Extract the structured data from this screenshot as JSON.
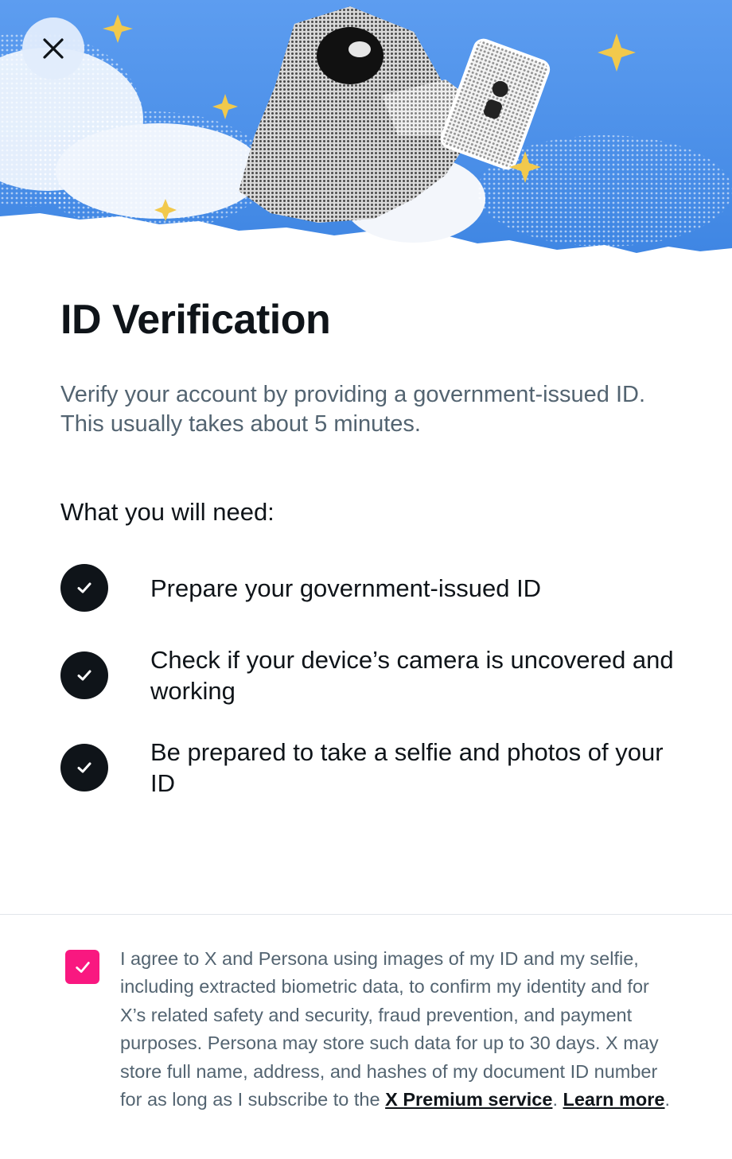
{
  "header": {
    "close_icon": "close-icon",
    "illustration": "astronaut-holding-id-card"
  },
  "main": {
    "title": "ID Verification",
    "subtitle": "Verify your account by providing a government-issued ID. This usually takes about 5 minutes.",
    "needs_heading": "What you will need:",
    "requirements": [
      {
        "icon": "check-circle-icon",
        "label": "Prepare your government-issued ID"
      },
      {
        "icon": "check-circle-icon",
        "label": "Check if your device’s camera is uncovered and working"
      },
      {
        "icon": "check-circle-icon",
        "label": "Be prepared to take a selfie and photos of your ID"
      }
    ]
  },
  "consent": {
    "checked": true,
    "text": "I agree to X and Persona using images of my ID and my selfie, including extracted biometric data, to confirm my identity and for X’s related safety and security, fraud prevention, and payment purposes. Persona may store such data for up to 30 days. X may store full name, address, and hashes of my document ID number for as long as I subscribe to the ",
    "premium_link": "X Premium service",
    "separator": ". ",
    "learn_more_link": "Learn more",
    "end": "."
  },
  "colors": {
    "sky": "#4a90e6",
    "text_primary": "#0f1419",
    "text_secondary": "#536471",
    "checkbox": "#f91880",
    "sparkle": "#f2c94c"
  }
}
